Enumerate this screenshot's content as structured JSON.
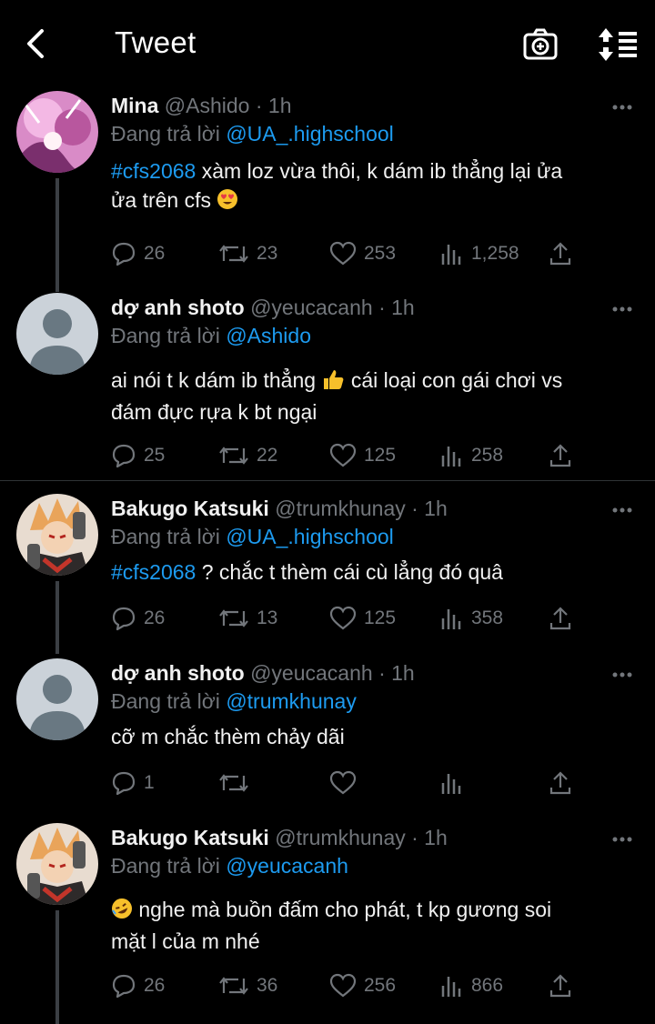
{
  "header": {
    "title": "Tweet",
    "back_icon": "back-arrow-icon",
    "camera_icon": "camera-plus-icon",
    "sort_icon": "sort-icon"
  },
  "colors": {
    "accent": "#1d9bf0",
    "muted": "#72767b",
    "background": "#000000"
  },
  "tweets": [
    {
      "name": "Mina",
      "handle": "@Ashido",
      "time": "· 1h",
      "reply_prefix": "Đang trả lời",
      "reply_to": "@UA_.highschool",
      "hashtag": "#cfs2068",
      "text": "xàm loz vừa thôi, k dám ib thẳng lại ửa",
      "text2": "ửa trên cfs",
      "emoji": "😍",
      "replies": "26",
      "retweets": "23",
      "likes": "253",
      "views": "1,258"
    },
    {
      "name": "dợ anh shoto",
      "handle": "@yeucacanh",
      "time": "· 1h",
      "reply_prefix": "Đang trả lời",
      "reply_to": "@Ashido",
      "text": "ai nói t k dám ib thẳng",
      "emoji": "👍",
      "text_after": "cái loại con gái chơi vs",
      "text2": "đám đực rựa k bt ngại",
      "replies": "25",
      "retweets": "22",
      "likes": "125",
      "views": "258"
    },
    {
      "name": "Bakugo Katsuki",
      "handle": "@trumkhunay",
      "time": "· 1h",
      "reply_prefix": "Đang trả lời",
      "reply_to": "@UA_.highschool",
      "hashtag": "#cfs2068",
      "text": "? chắc t thèm cái cù lẳng đó quâ",
      "replies": "26",
      "retweets": "13",
      "likes": "125",
      "views": "358"
    },
    {
      "name": "dợ anh shoto",
      "handle": "@yeucacanh",
      "time": "· 1h",
      "reply_prefix": "Đang trả lời",
      "reply_to": "@trumkhunay",
      "text": "cỡ m chắc thèm chảy dãi",
      "replies": "1",
      "retweets": "",
      "likes": "",
      "views": ""
    },
    {
      "name": "Bakugo Katsuki",
      "handle": "@trumkhunay",
      "time": "· 1h",
      "reply_prefix": "Đang trả lời",
      "reply_to": "@yeucacanh",
      "emoji": "🤣",
      "text": "nghe mà buồn đấm cho phát, t kp gương soi",
      "text2": "mặt l của m nhé",
      "replies": "26",
      "retweets": "36",
      "likes": "256",
      "views": "866"
    }
  ]
}
